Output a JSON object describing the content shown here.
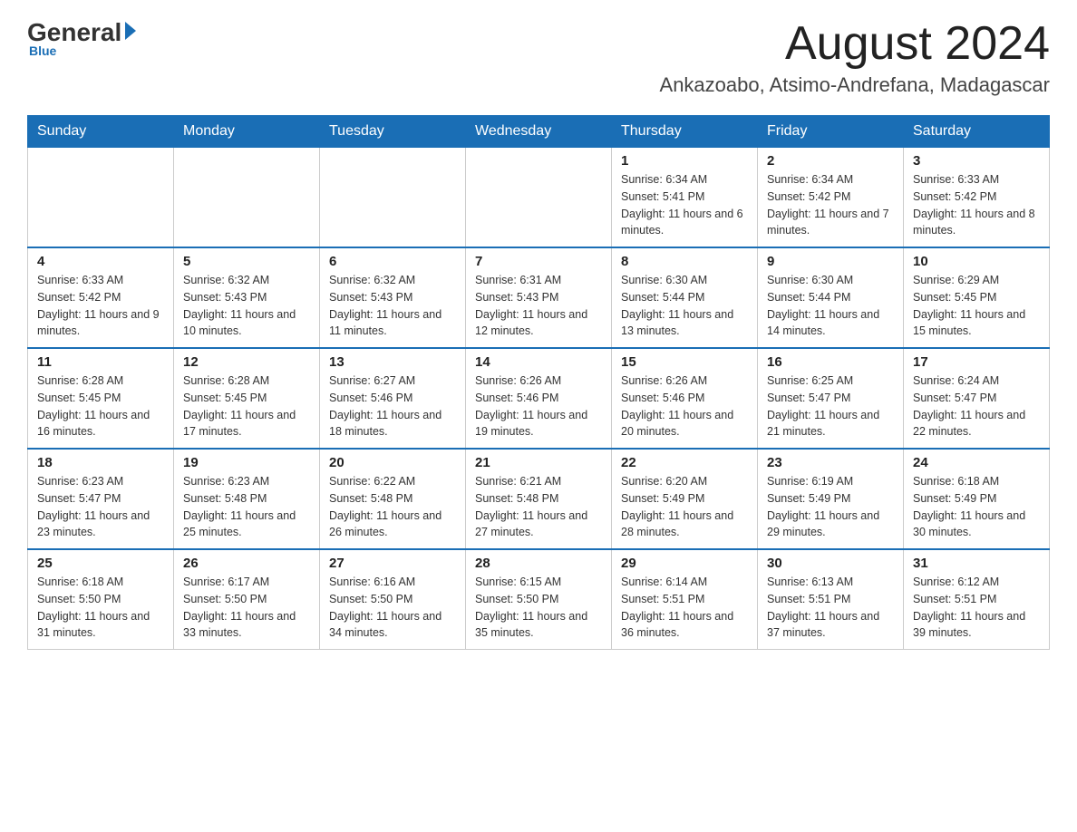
{
  "logo": {
    "general": "General",
    "blue": "Blue"
  },
  "header": {
    "month": "August 2024",
    "location": "Ankazoabo, Atsimo-Andrefana, Madagascar"
  },
  "days_of_week": [
    "Sunday",
    "Monday",
    "Tuesday",
    "Wednesday",
    "Thursday",
    "Friday",
    "Saturday"
  ],
  "weeks": [
    [
      {
        "day": "",
        "info": ""
      },
      {
        "day": "",
        "info": ""
      },
      {
        "day": "",
        "info": ""
      },
      {
        "day": "",
        "info": ""
      },
      {
        "day": "1",
        "info": "Sunrise: 6:34 AM\nSunset: 5:41 PM\nDaylight: 11 hours and 6 minutes."
      },
      {
        "day": "2",
        "info": "Sunrise: 6:34 AM\nSunset: 5:42 PM\nDaylight: 11 hours and 7 minutes."
      },
      {
        "day": "3",
        "info": "Sunrise: 6:33 AM\nSunset: 5:42 PM\nDaylight: 11 hours and 8 minutes."
      }
    ],
    [
      {
        "day": "4",
        "info": "Sunrise: 6:33 AM\nSunset: 5:42 PM\nDaylight: 11 hours and 9 minutes."
      },
      {
        "day": "5",
        "info": "Sunrise: 6:32 AM\nSunset: 5:43 PM\nDaylight: 11 hours and 10 minutes."
      },
      {
        "day": "6",
        "info": "Sunrise: 6:32 AM\nSunset: 5:43 PM\nDaylight: 11 hours and 11 minutes."
      },
      {
        "day": "7",
        "info": "Sunrise: 6:31 AM\nSunset: 5:43 PM\nDaylight: 11 hours and 12 minutes."
      },
      {
        "day": "8",
        "info": "Sunrise: 6:30 AM\nSunset: 5:44 PM\nDaylight: 11 hours and 13 minutes."
      },
      {
        "day": "9",
        "info": "Sunrise: 6:30 AM\nSunset: 5:44 PM\nDaylight: 11 hours and 14 minutes."
      },
      {
        "day": "10",
        "info": "Sunrise: 6:29 AM\nSunset: 5:45 PM\nDaylight: 11 hours and 15 minutes."
      }
    ],
    [
      {
        "day": "11",
        "info": "Sunrise: 6:28 AM\nSunset: 5:45 PM\nDaylight: 11 hours and 16 minutes."
      },
      {
        "day": "12",
        "info": "Sunrise: 6:28 AM\nSunset: 5:45 PM\nDaylight: 11 hours and 17 minutes."
      },
      {
        "day": "13",
        "info": "Sunrise: 6:27 AM\nSunset: 5:46 PM\nDaylight: 11 hours and 18 minutes."
      },
      {
        "day": "14",
        "info": "Sunrise: 6:26 AM\nSunset: 5:46 PM\nDaylight: 11 hours and 19 minutes."
      },
      {
        "day": "15",
        "info": "Sunrise: 6:26 AM\nSunset: 5:46 PM\nDaylight: 11 hours and 20 minutes."
      },
      {
        "day": "16",
        "info": "Sunrise: 6:25 AM\nSunset: 5:47 PM\nDaylight: 11 hours and 21 minutes."
      },
      {
        "day": "17",
        "info": "Sunrise: 6:24 AM\nSunset: 5:47 PM\nDaylight: 11 hours and 22 minutes."
      }
    ],
    [
      {
        "day": "18",
        "info": "Sunrise: 6:23 AM\nSunset: 5:47 PM\nDaylight: 11 hours and 23 minutes."
      },
      {
        "day": "19",
        "info": "Sunrise: 6:23 AM\nSunset: 5:48 PM\nDaylight: 11 hours and 25 minutes."
      },
      {
        "day": "20",
        "info": "Sunrise: 6:22 AM\nSunset: 5:48 PM\nDaylight: 11 hours and 26 minutes."
      },
      {
        "day": "21",
        "info": "Sunrise: 6:21 AM\nSunset: 5:48 PM\nDaylight: 11 hours and 27 minutes."
      },
      {
        "day": "22",
        "info": "Sunrise: 6:20 AM\nSunset: 5:49 PM\nDaylight: 11 hours and 28 minutes."
      },
      {
        "day": "23",
        "info": "Sunrise: 6:19 AM\nSunset: 5:49 PM\nDaylight: 11 hours and 29 minutes."
      },
      {
        "day": "24",
        "info": "Sunrise: 6:18 AM\nSunset: 5:49 PM\nDaylight: 11 hours and 30 minutes."
      }
    ],
    [
      {
        "day": "25",
        "info": "Sunrise: 6:18 AM\nSunset: 5:50 PM\nDaylight: 11 hours and 31 minutes."
      },
      {
        "day": "26",
        "info": "Sunrise: 6:17 AM\nSunset: 5:50 PM\nDaylight: 11 hours and 33 minutes."
      },
      {
        "day": "27",
        "info": "Sunrise: 6:16 AM\nSunset: 5:50 PM\nDaylight: 11 hours and 34 minutes."
      },
      {
        "day": "28",
        "info": "Sunrise: 6:15 AM\nSunset: 5:50 PM\nDaylight: 11 hours and 35 minutes."
      },
      {
        "day": "29",
        "info": "Sunrise: 6:14 AM\nSunset: 5:51 PM\nDaylight: 11 hours and 36 minutes."
      },
      {
        "day": "30",
        "info": "Sunrise: 6:13 AM\nSunset: 5:51 PM\nDaylight: 11 hours and 37 minutes."
      },
      {
        "day": "31",
        "info": "Sunrise: 6:12 AM\nSunset: 5:51 PM\nDaylight: 11 hours and 39 minutes."
      }
    ]
  ]
}
